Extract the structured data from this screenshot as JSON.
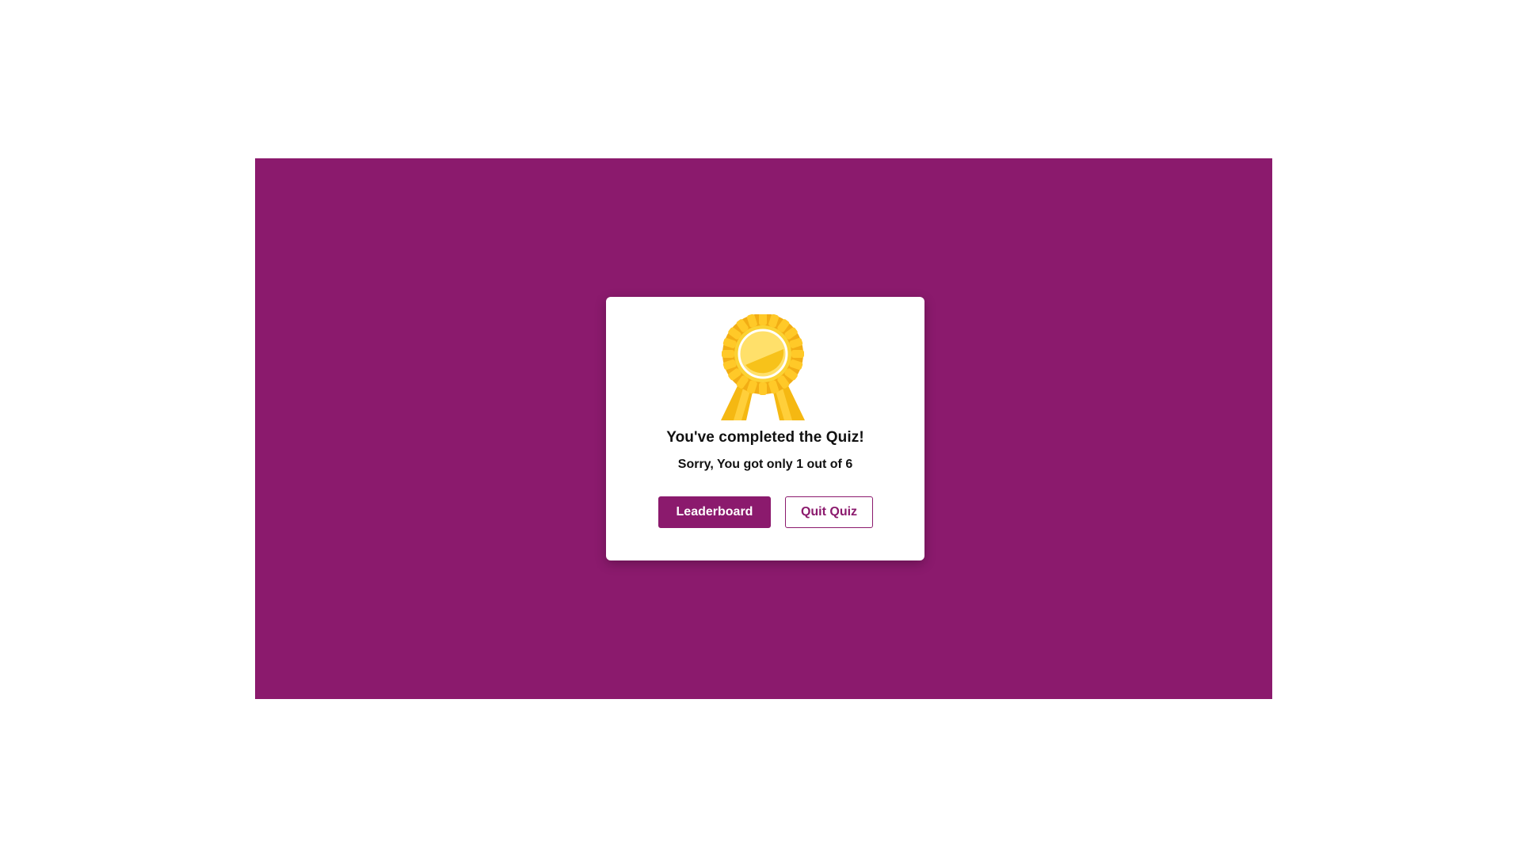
{
  "colors": {
    "accent": "#8b1a6d",
    "background": "#ffffff",
    "medal_gold": "#f7c21a"
  },
  "result": {
    "title": "You've completed the Quiz!",
    "score_prefix": "Sorry, You got only ",
    "score_correct": "1",
    "score_middle": " out of ",
    "score_total": "6"
  },
  "actions": {
    "leaderboard_label": "Leaderboard",
    "quit_label": "Quit Quiz"
  },
  "icons": {
    "medal": "award-medal-icon"
  }
}
